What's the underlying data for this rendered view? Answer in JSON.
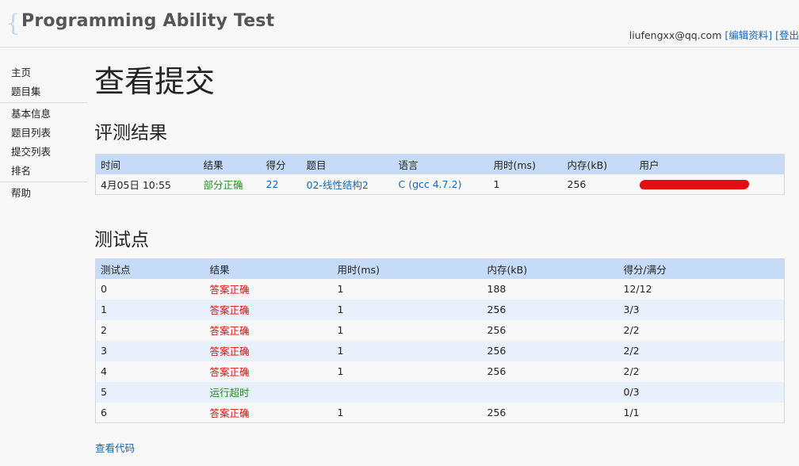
{
  "header": {
    "logo_brace": "{",
    "logo_text": "Programming Ability Test",
    "email": "liufengxx@qq.com",
    "edit_profile": "[编辑资料]",
    "logout": "[登出"
  },
  "sidebar": {
    "groups": [
      [
        "主页",
        "题目集"
      ],
      [
        "基本信息",
        "题目列表",
        "提交列表",
        "排名"
      ],
      [
        "帮助"
      ]
    ]
  },
  "page_title": "查看提交",
  "result_section": {
    "title": "评测结果",
    "headers": [
      "时间",
      "结果",
      "得分",
      "题目",
      "语言",
      "用时(ms)",
      "内存(kB)",
      "用户"
    ],
    "row": {
      "time": "4月05日 10:55",
      "result": "部分正确",
      "score": "22",
      "problem": "02-线性结构2",
      "language": "C (gcc 4.7.2)",
      "time_ms": "1",
      "memory_kb": "256",
      "user_redacted": true
    }
  },
  "testpoints_section": {
    "title": "测试点",
    "headers": [
      "测试点",
      "结果",
      "用时(ms)",
      "内存(kB)",
      "得分/满分"
    ],
    "rows": [
      {
        "id": "0",
        "result": "答案正确",
        "status": "ok",
        "time": "1",
        "memory": "188",
        "score": "12/12"
      },
      {
        "id": "1",
        "result": "答案正确",
        "status": "ok",
        "time": "1",
        "memory": "256",
        "score": "3/3"
      },
      {
        "id": "2",
        "result": "答案正确",
        "status": "ok",
        "time": "1",
        "memory": "256",
        "score": "2/2"
      },
      {
        "id": "3",
        "result": "答案正确",
        "status": "ok",
        "time": "1",
        "memory": "256",
        "score": "2/2"
      },
      {
        "id": "4",
        "result": "答案正确",
        "status": "ok",
        "time": "1",
        "memory": "256",
        "score": "2/2"
      },
      {
        "id": "5",
        "result": "运行超时",
        "status": "tle",
        "time": "",
        "memory": "",
        "score": "0/3"
      },
      {
        "id": "6",
        "result": "答案正确",
        "status": "ok",
        "time": "1",
        "memory": "256",
        "score": "1/1"
      }
    ]
  },
  "view_code": "查看代码",
  "colors": {
    "link": "#1a66b3",
    "accepted": "#dd1111",
    "partial": "#2a8a2a",
    "timeout": "#2a8a2a",
    "table_header": "#c6dbf7",
    "row_alt": "#e8f0fb"
  }
}
